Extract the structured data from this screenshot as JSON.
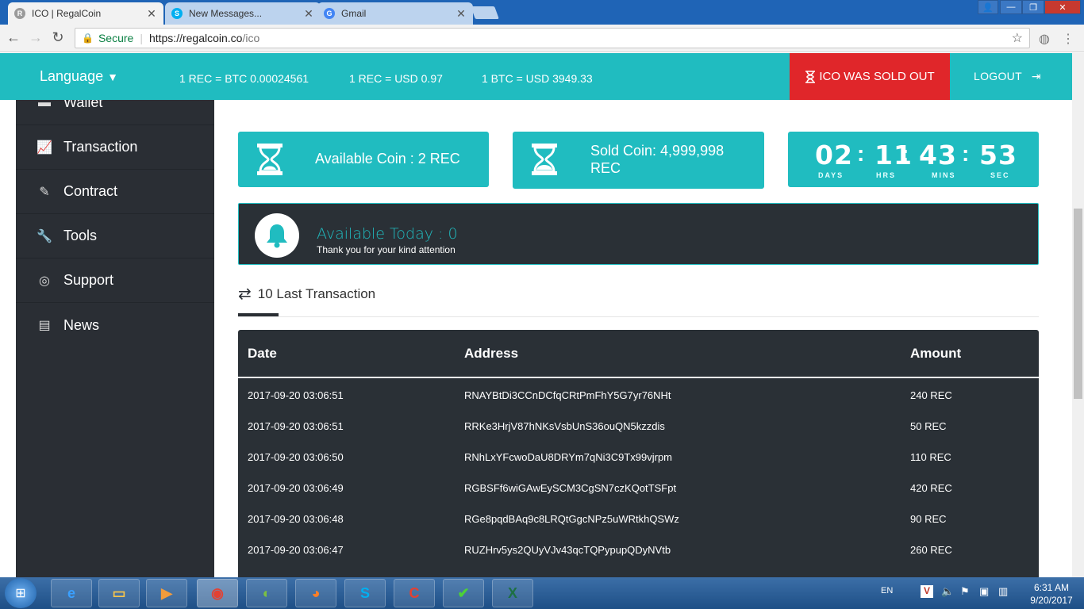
{
  "browser": {
    "tabs": [
      {
        "title": "ICO | RegalCoin",
        "active": true,
        "icon": "regalcoin-favicon"
      },
      {
        "title": "New Messages...",
        "active": false,
        "icon": "skype-favicon"
      },
      {
        "title": "Gmail",
        "active": false,
        "icon": "google-favicon"
      }
    ],
    "secure_label": "Secure",
    "url_host": "https://regalcoin.co",
    "url_path": "/ico"
  },
  "header": {
    "language_label": "Language",
    "rates": [
      "1 REC = BTC 0.00024561",
      "1 REC = USD 0.97",
      "1 BTC = USD 3949.33"
    ],
    "sold_out_label": "ICO WAS SOLD OUT",
    "logout_label": "LOGOUT"
  },
  "sidebar": {
    "items": [
      {
        "label": "Wallet",
        "icon": "wallet-icon"
      },
      {
        "label": "Transaction",
        "icon": "line-chart-icon"
      },
      {
        "label": "Contract",
        "icon": "edit-icon"
      },
      {
        "label": "Tools",
        "icon": "wrench-icon"
      },
      {
        "label": "Support",
        "icon": "lifebuoy-icon"
      },
      {
        "label": "News",
        "icon": "newspaper-icon"
      }
    ]
  },
  "stats": {
    "available_coin": "Available Coin : 2 REC",
    "sold_coin_line1": "Sold Coin: 4,999,998",
    "sold_coin_line2": "REC"
  },
  "countdown": {
    "days": "02",
    "hours": "11",
    "mins": "43",
    "secs": "53",
    "days_label": "DAYS",
    "hours_label": "HRS",
    "mins_label": "MINS",
    "secs_label": "SEC"
  },
  "notice": {
    "title": "Available Today : 0",
    "subtitle": "Thank you for your kind attention"
  },
  "transactions": {
    "heading": "10 Last Transaction",
    "columns": [
      "Date",
      "Address",
      "Amount"
    ],
    "rows": [
      {
        "date": "2017-09-20 03:06:51",
        "address": "RNAYBtDi3CCnDCfqCRtPmFhY5G7yr76NHt",
        "amount": "240 REC"
      },
      {
        "date": "2017-09-20 03:06:51",
        "address": "RRKe3HrjV87hNKsVsbUnS36ouQN5kzzdis",
        "amount": "50 REC"
      },
      {
        "date": "2017-09-20 03:06:50",
        "address": "RNhLxYFcwoDaU8DRYm7qNi3C9Tx99vjrpm",
        "amount": "110 REC"
      },
      {
        "date": "2017-09-20 03:06:49",
        "address": "RGBSFf6wiGAwEySCM3CgSN7czKQotTSFpt",
        "amount": "420 REC"
      },
      {
        "date": "2017-09-20 03:06:48",
        "address": "RGe8pqdBAq9c8LRQtGgcNPz5uWRtkhQSWz",
        "amount": "90 REC"
      },
      {
        "date": "2017-09-20 03:06:47",
        "address": "RUZHrv5ys2QUyVJv43qcTQPypupQDyNVtb",
        "amount": "260 REC"
      }
    ]
  },
  "taskbar": {
    "language": "EN",
    "time": "6:31 AM",
    "date": "9/20/2017"
  }
}
